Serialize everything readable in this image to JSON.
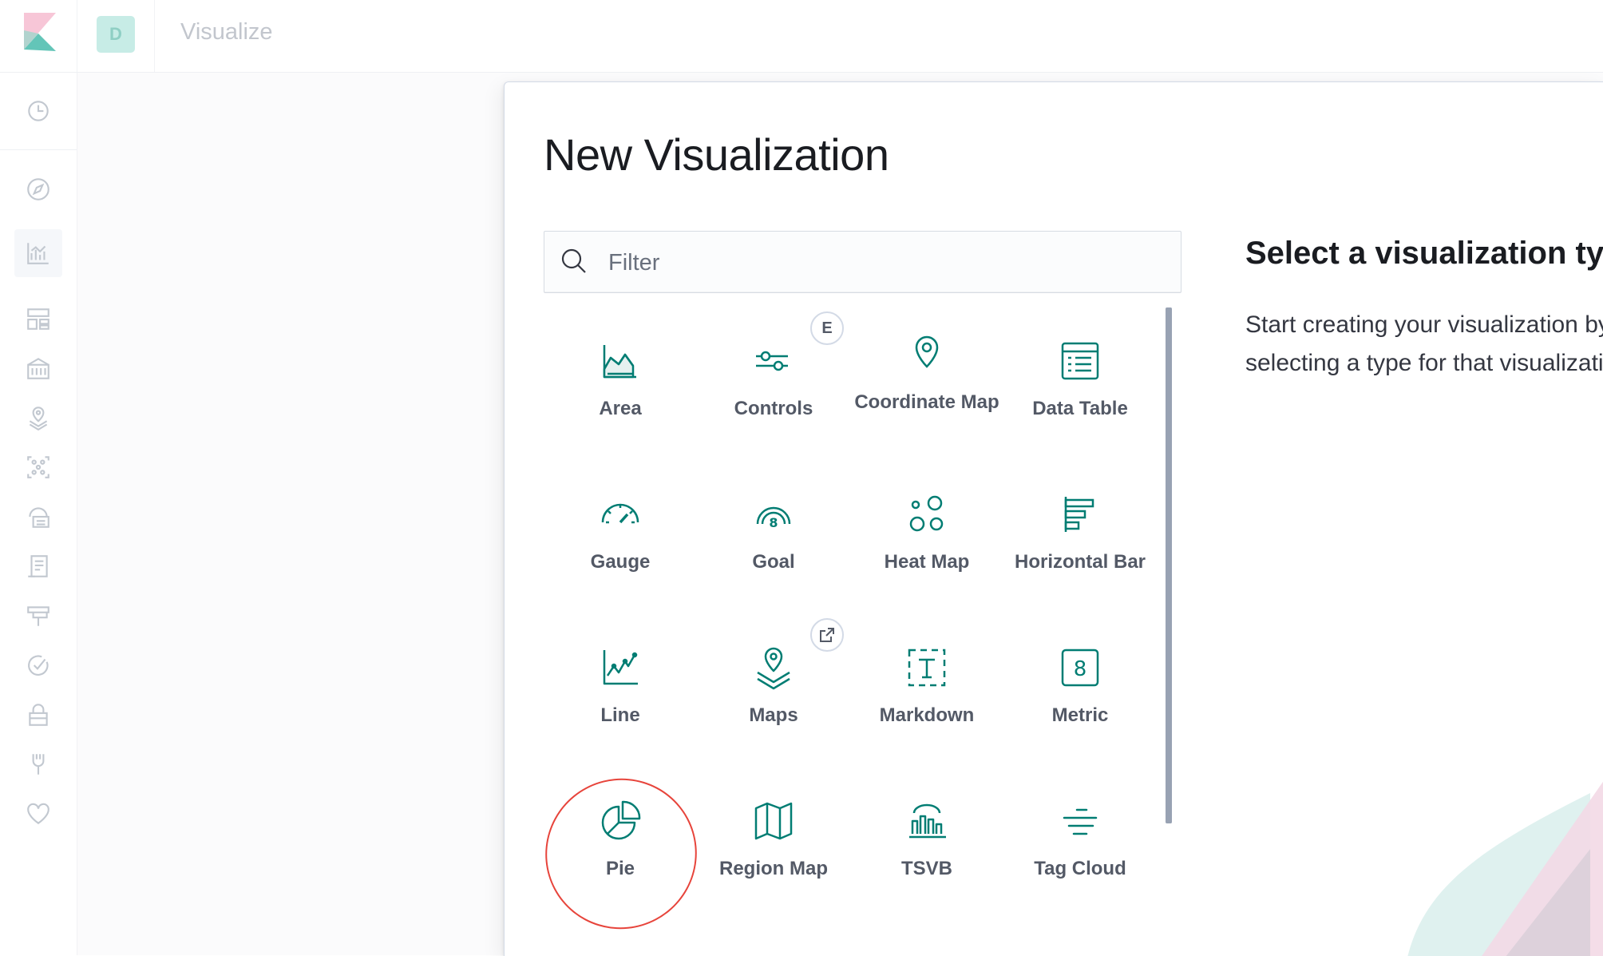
{
  "header": {
    "space_initial": "D",
    "app_title": "Visualize"
  },
  "modal": {
    "title": "New Visualization",
    "search": {
      "placeholder": "Filter",
      "value": ""
    },
    "description": {
      "title": "Select a visualization type",
      "text": "Start creating your visualization by selecting a type for that visualization."
    },
    "types": [
      {
        "label": "Area",
        "icon": "area-chart-icon"
      },
      {
        "label": "Controls",
        "icon": "controls-icon",
        "badge": "E"
      },
      {
        "label": "Coordinate Map",
        "icon": "map-pin-icon"
      },
      {
        "label": "Data Table",
        "icon": "data-table-icon"
      },
      {
        "label": "Gauge",
        "icon": "gauge-icon"
      },
      {
        "label": "Goal",
        "icon": "goal-icon"
      },
      {
        "label": "Heat Map",
        "icon": "heat-map-icon"
      },
      {
        "label": "Horizontal Bar",
        "icon": "horizontal-bar-icon"
      },
      {
        "label": "Line",
        "icon": "line-chart-icon"
      },
      {
        "label": "Maps",
        "icon": "maps-icon",
        "badge_icon": "external-link-icon"
      },
      {
        "label": "Markdown",
        "icon": "markdown-icon"
      },
      {
        "label": "Metric",
        "icon": "metric-icon"
      },
      {
        "label": "Pie",
        "icon": "pie-chart-icon"
      },
      {
        "label": "Region Map",
        "icon": "region-map-icon"
      },
      {
        "label": "TSVB",
        "icon": "tsvb-icon"
      },
      {
        "label": "Tag Cloud",
        "icon": "tag-cloud-icon"
      }
    ]
  },
  "sidenav": {
    "items": [
      "recent-clock-icon",
      "discover-compass-icon",
      "visualize-icon",
      "dashboard-icon",
      "canvas-icon",
      "maps-nav-icon",
      "ml-icon",
      "infrastructure-icon",
      "logs-icon",
      "apm-icon",
      "uptime-icon",
      "siem-lock-icon",
      "dev-tools-icon",
      "monitoring-heart-icon"
    ]
  },
  "colors": {
    "accent": "#017d73",
    "highlight": "#e7443b",
    "nav_icon": "#c2c8d0"
  }
}
